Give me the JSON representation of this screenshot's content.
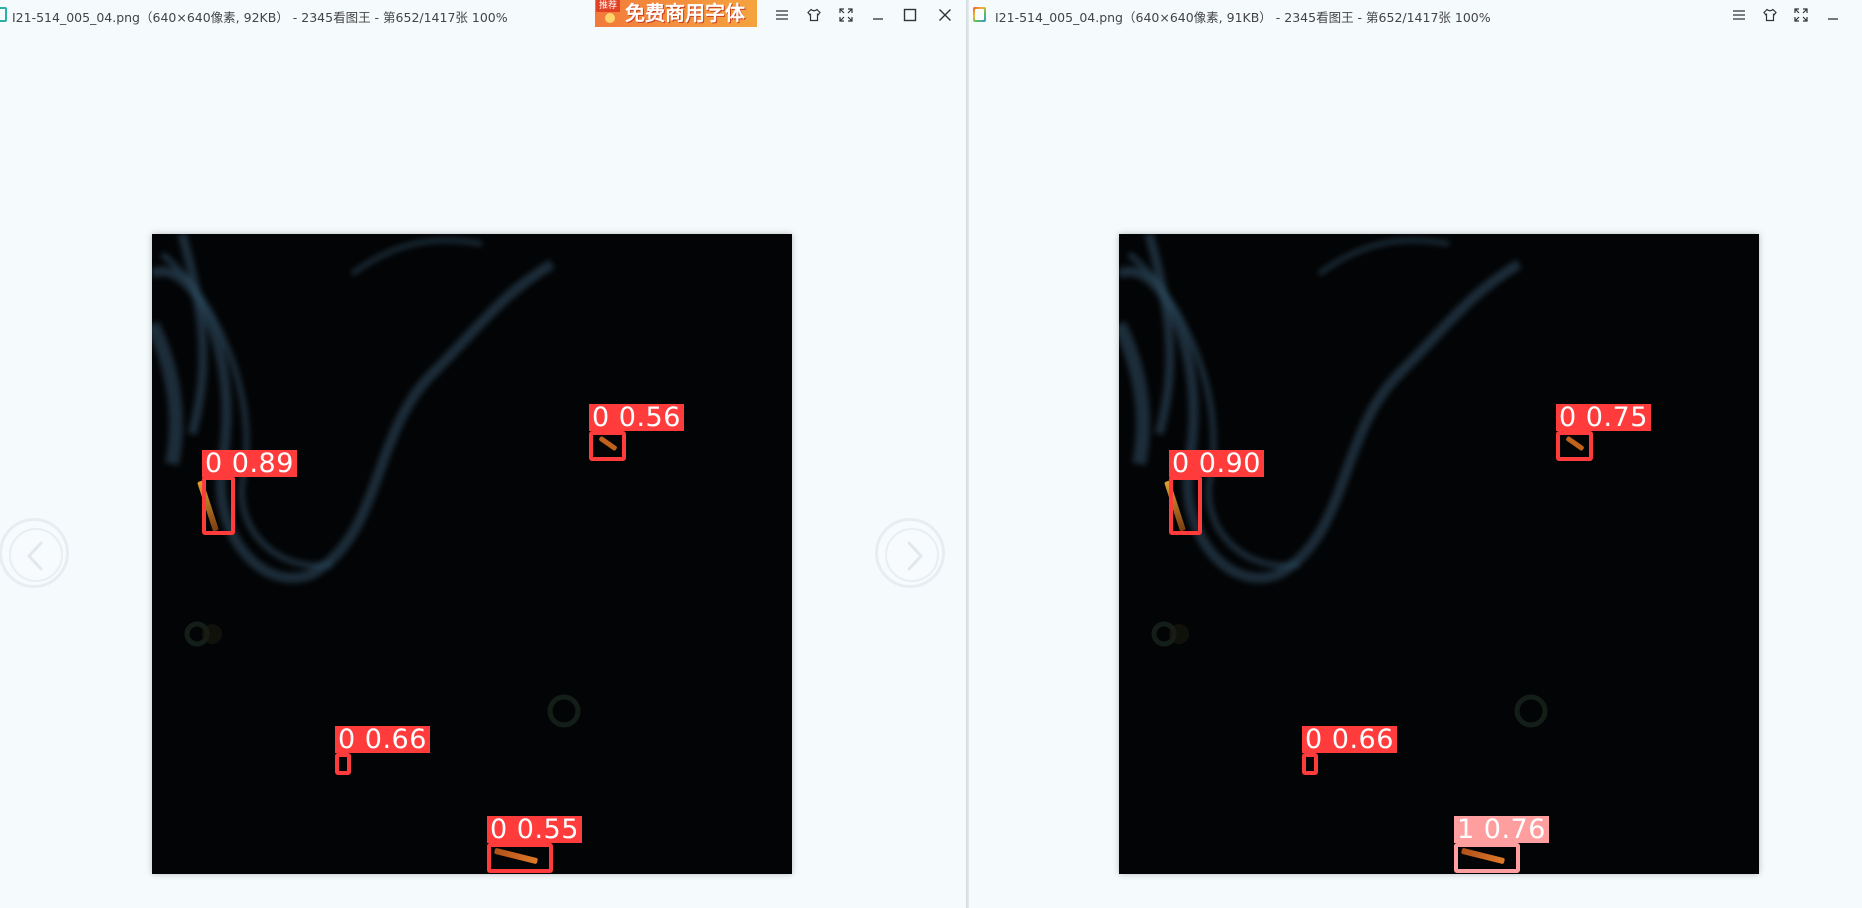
{
  "left_window": {
    "title": "I21-514_005_04.png（640×640像素, 92KB） - 2345看图王 - 第652/1417张 100%",
    "ad": {
      "tag": "推荐",
      "text": "免费商用字体"
    },
    "controls": [
      "menu-icon",
      "skin-icon",
      "fullscreen-icon",
      "minimize-icon",
      "maximize-icon",
      "close-icon"
    ],
    "detections": [
      {
        "label": "0  0.89",
        "class": 0,
        "confidence": 0.89
      },
      {
        "label": "0  0.56",
        "class": 0,
        "confidence": 0.56
      },
      {
        "label": "0  0.66",
        "class": 0,
        "confidence": 0.66
      },
      {
        "label": "0  0.55",
        "class": 0,
        "confidence": 0.55
      }
    ]
  },
  "right_window": {
    "title": "I21-514_005_04.png（640×640像素, 91KB） - 2345看图王 - 第652/1417张 100%",
    "controls": [
      "menu-icon",
      "skin-icon",
      "fullscreen-icon",
      "minimize-icon"
    ],
    "detections": [
      {
        "label": "0  0.90",
        "class": 0,
        "confidence": 0.9
      },
      {
        "label": "0  0.75",
        "class": 0,
        "confidence": 0.75
      },
      {
        "label": "0  0.66",
        "class": 0,
        "confidence": 0.66
      },
      {
        "label": "1  0.76",
        "class": 1,
        "confidence": 0.76
      }
    ]
  },
  "colors": {
    "class_0": "#ff3b3b",
    "class_1": "#ff9e9e",
    "background": "#f5fafd",
    "image_bg": "#030405"
  }
}
